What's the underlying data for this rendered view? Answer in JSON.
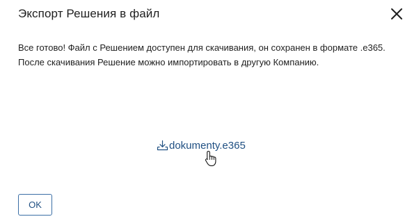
{
  "dialog": {
    "title": "Экспорт Решения в файл",
    "close_icon": "close-icon",
    "message": "Все готово! Файл с Решением доступен для скачивания, он сохранен в формате .e365. После скачивания Решение можно импортировать в другую Компанию.",
    "download": {
      "icon": "download-icon",
      "filename": "dokumenty.e365"
    },
    "ok_label": "OK"
  },
  "colors": {
    "link": "#1f4f82",
    "button_border": "#3a6ea5",
    "text": "#1e1e1e",
    "background": "#ffffff"
  }
}
